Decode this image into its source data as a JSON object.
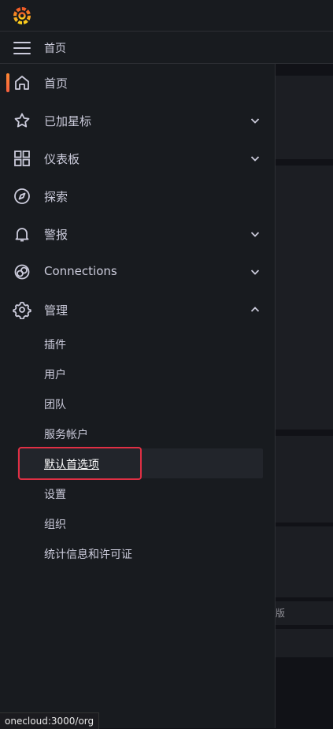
{
  "header": {
    "breadcrumb": "首页"
  },
  "background": {
    "hint_text": "版"
  },
  "nav": {
    "items": [
      {
        "label": "首页",
        "icon": "home-icon",
        "active": true
      },
      {
        "label": "已加星标",
        "icon": "star-icon",
        "expanded": false
      },
      {
        "label": "仪表板",
        "icon": "apps-icon",
        "expanded": false
      },
      {
        "label": "探索",
        "icon": "compass-icon"
      },
      {
        "label": "警报",
        "icon": "bell-icon",
        "expanded": false
      },
      {
        "label": "Connections",
        "icon": "connections-icon",
        "expanded": false
      },
      {
        "label": "管理",
        "icon": "cog-icon",
        "expanded": true
      }
    ],
    "admin_children": [
      {
        "label": "插件"
      },
      {
        "label": "用户"
      },
      {
        "label": "团队"
      },
      {
        "label": "服务帐户"
      },
      {
        "label": "默认首选项",
        "selected": true
      },
      {
        "label": "设置"
      },
      {
        "label": "组织"
      },
      {
        "label": "统计信息和许可证"
      }
    ]
  },
  "status_bar": {
    "url": "onecloud:3000/org"
  },
  "colors": {
    "accent": "#f55f3e",
    "highlight_box": "#e02f44",
    "sidebar_bg": "#181b1f"
  }
}
